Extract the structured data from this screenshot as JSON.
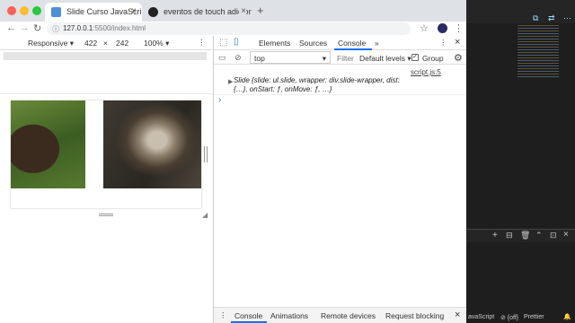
{
  "browser": {
    "tabs": [
      {
        "title": "Slide Curso JavaScript",
        "active": true
      },
      {
        "title": "eventos de touch adicionados...",
        "active": false
      }
    ],
    "new_tab": "+",
    "url_host": "127.0.0.1",
    "url_path": ":5500/index.html"
  },
  "device_toolbar": {
    "mode": "Responsive ▾",
    "width": "422",
    "times": "×",
    "height": "242",
    "zoom": "100% ▾"
  },
  "devtools": {
    "tabs": [
      "Elements",
      "Sources",
      "Console"
    ],
    "active_tab": "Console",
    "more": "»",
    "context": "top",
    "filter_placeholder": "Filter",
    "levels": "Default levels ▾",
    "group_label": "Group",
    "console": {
      "source": "script.js:5",
      "line1": "Slide {slide: ul.slide, wrapper: div.slide-wrapper, dist:",
      "line2": "{…}, onStart: ƒ, onMove: ƒ, …}",
      "prompt": "›"
    },
    "drawer_tabs": [
      "Console",
      "Animations",
      "Remote devices",
      "Request blocking"
    ]
  },
  "editor": {
    "status": "avaScript",
    "status2": "⊘ {off}",
    "prettier": "Prettier"
  }
}
